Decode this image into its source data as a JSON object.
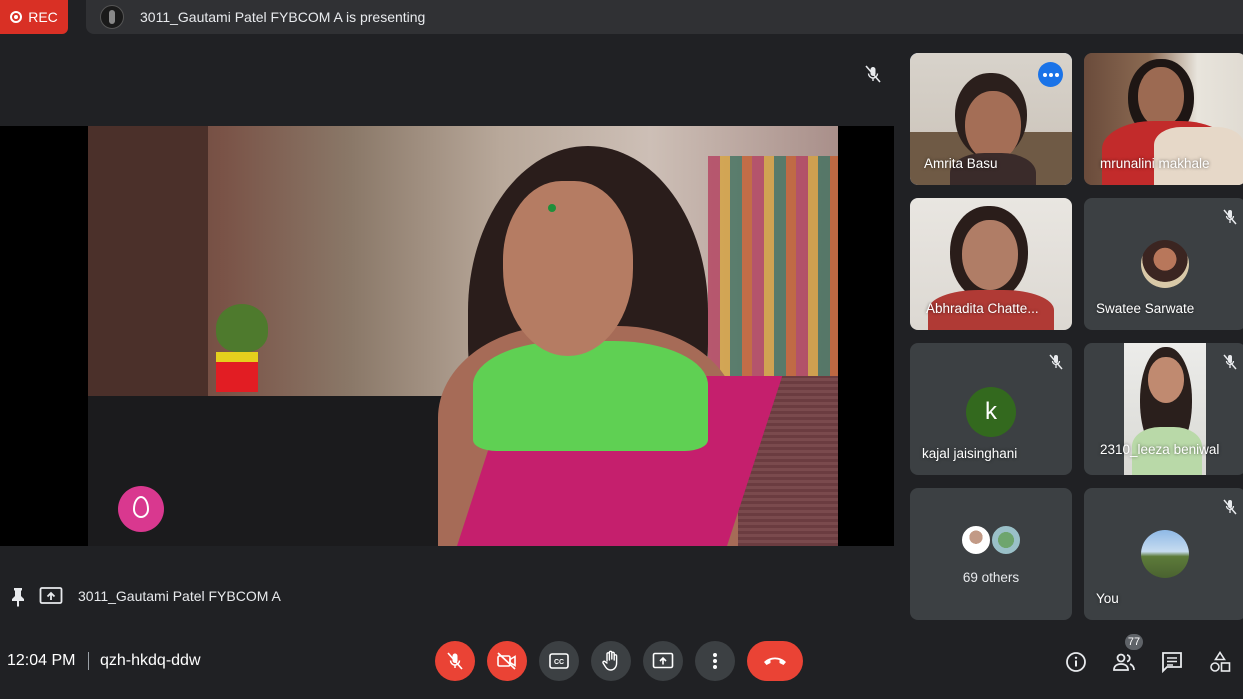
{
  "top_bar": {
    "rec_label": "REC",
    "presenting_text": "3011_Gautami Patel FYBCOM A is presenting"
  },
  "stage": {
    "presenter_name": "3011_Gautami Patel FYBCOM A"
  },
  "participants": [
    {
      "name": "Amrita Basu",
      "muted": false,
      "active_speaker": true
    },
    {
      "name": "mrunalini makhale",
      "muted": false
    },
    {
      "name": "Abhradita Chatte...",
      "muted": false
    },
    {
      "name": "Swatee Sarwate",
      "muted": true
    },
    {
      "name": "kajal jaisinghani",
      "muted": true,
      "avatar_letter": "k"
    },
    {
      "name": "2310_leeza beniwal",
      "muted": true
    },
    {
      "others_label": "69 others"
    },
    {
      "name": "You",
      "muted": true
    }
  ],
  "bottom_bar": {
    "time": "12:04 PM",
    "meeting_code": "qzh-hkdq-ddw",
    "participant_count": "77",
    "controls": [
      "mic-off-icon",
      "camera-off-icon",
      "captions-icon",
      "raise-hand-icon",
      "present-screen-icon",
      "more-options-icon",
      "leave-call-icon"
    ],
    "right_icons": [
      "info-icon",
      "people-icon",
      "chat-icon",
      "activities-icon"
    ]
  },
  "colors": {
    "background": "#202124",
    "tile": "#3c4043",
    "red": "#ea4335",
    "accent_blue": "#8ab4f8"
  }
}
